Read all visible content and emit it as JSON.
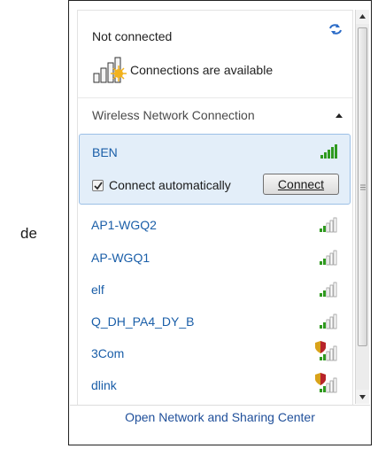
{
  "side_text": "de",
  "status": {
    "title": "Not connected",
    "connections_text": "Connections are available"
  },
  "section": {
    "label": "Wireless Network Connection"
  },
  "selected_network": {
    "name": "BEN",
    "auto_connect_label": "Connect automatically",
    "auto_connect_checked": true,
    "connect_button_label": "Connect"
  },
  "networks": [
    {
      "name": "AP1-WGQ2",
      "secured": false
    },
    {
      "name": "AP-WGQ1",
      "secured": false
    },
    {
      "name": "elf",
      "secured": false
    },
    {
      "name": "Q_DH_PA4_DY_B",
      "secured": false
    },
    {
      "name": "3Com",
      "secured": true
    },
    {
      "name": "dlink",
      "secured": true
    }
  ],
  "footer": {
    "link": "Open Network and Sharing Center"
  },
  "colors": {
    "link_blue": "#1a5ea8",
    "signal_green": "#2f9a1f",
    "selection_bg": "#e3eef9"
  }
}
